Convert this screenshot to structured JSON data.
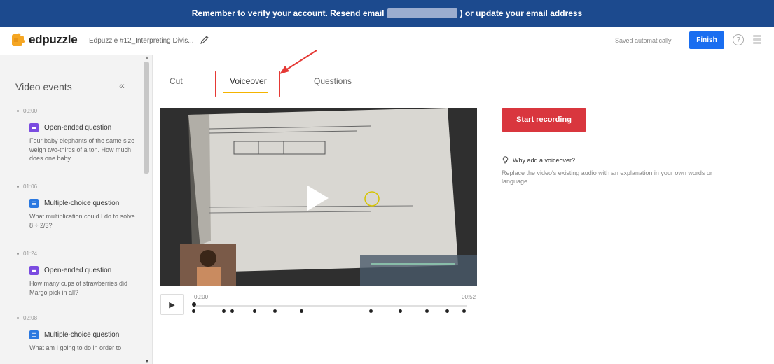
{
  "banner": {
    "text_before": "Remember to verify your account. Resend email",
    "text_after": ") or update your email address"
  },
  "header": {
    "logo_text": "edpuzzle",
    "doc_title": "Edpuzzle #12_Interpreting Divis...",
    "saved_status": "Saved automatically",
    "finish_label": "Finish",
    "help_label": "?"
  },
  "sidebar": {
    "title": "Video events",
    "collapse_glyph": "«",
    "events": [
      {
        "time": "00:00",
        "type": "Open-ended question",
        "text": "Four baby elephants of the same size weigh two-thirds of a ton. How much does one baby..."
      },
      {
        "time": "01:06",
        "type": "Multiple-choice question",
        "text": "What multiplication could I do to solve 8 ÷ 2/3?"
      },
      {
        "time": "01:24",
        "type": "Open-ended question",
        "text": "How many cups of strawberries did Margo pick in all?"
      },
      {
        "time": "02:08",
        "type": "Multiple-choice question",
        "text": "What am I going to do in order to"
      }
    ]
  },
  "tabs": {
    "cut": "Cut",
    "voiceover": "Voiceover",
    "questions": "Questions",
    "active": "Voiceover"
  },
  "player": {
    "current_time": "00:00",
    "end_time": "00:52",
    "play_glyph": "▶"
  },
  "voiceover": {
    "record_label": "Start recording",
    "why_title": "Why add a voiceover?",
    "why_description": "Replace the video's existing audio with an explanation in your own words or language."
  },
  "colors": {
    "banner": "#1c4a8e",
    "finish": "#1a6ef0",
    "record": "#d9363e",
    "tab_underline": "#f4b400",
    "annotation": "#e53935"
  }
}
